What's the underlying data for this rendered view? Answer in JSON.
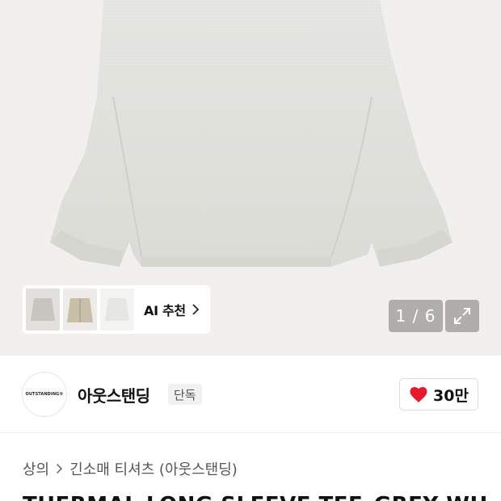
{
  "gallery": {
    "recommend_label": "AI 추천",
    "counter": "1 / 6",
    "thumbnails": [
      "sweater-gray",
      "jacket-beige",
      "sweater-white"
    ]
  },
  "brand": {
    "logo_text": "OUTSTANDING®",
    "name": "아웃스탠딩",
    "exclusive_badge": "단독",
    "like_count": "30만",
    "like_color": "#e8192c"
  },
  "breadcrumb": {
    "items": [
      "상의",
      "긴소매 티셔츠 (아웃스탠딩)"
    ]
  },
  "product": {
    "title": "THERMAL LONG SLEEVE TEE_GREY WH"
  }
}
